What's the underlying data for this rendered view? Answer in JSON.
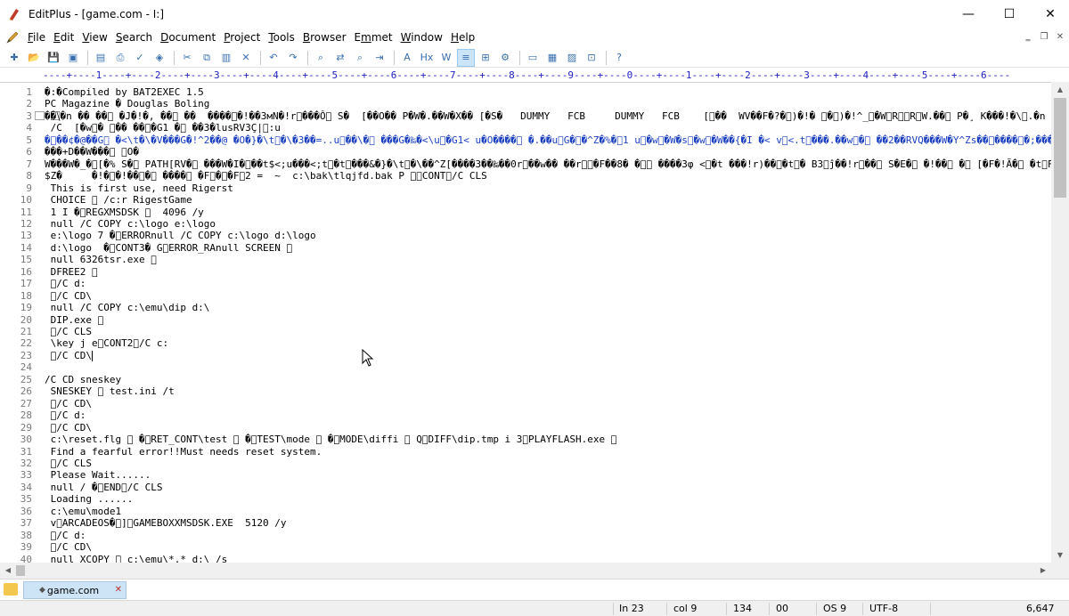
{
  "window": {
    "title": "EditPlus - [game.com - I:]",
    "controls": {
      "minimize": "—",
      "maximize": "☐",
      "close": "✕"
    }
  },
  "menu": [
    {
      "label": "File",
      "key": "F",
      "rest": "ile"
    },
    {
      "label": "Edit",
      "key": "E",
      "rest": "dit"
    },
    {
      "label": "View",
      "key": "V",
      "rest": "iew"
    },
    {
      "label": "Search",
      "key": "S",
      "rest": "earch"
    },
    {
      "label": "Document",
      "key": "D",
      "rest": "ocument"
    },
    {
      "label": "Project",
      "key": "P",
      "rest": "roject"
    },
    {
      "label": "Tools",
      "key": "T",
      "rest": "ools"
    },
    {
      "label": "Browser",
      "key": "B",
      "rest": "rowser"
    },
    {
      "label": "Emmet",
      "key": "m",
      "pre": "E",
      "rest": "met"
    },
    {
      "label": "Window",
      "key": "W",
      "rest": "indow"
    },
    {
      "label": "Help",
      "key": "H",
      "rest": "elp"
    }
  ],
  "mdi_controls": {
    "minimize": "‗",
    "restore": "❐",
    "close": "✕"
  },
  "toolbar": {
    "icons": [
      "new-file-icon",
      "open-icon",
      "save-icon",
      "save-all-icon",
      "sep",
      "print-preview-icon",
      "print-icon",
      "spell-check-icon",
      "browser-icon",
      "sep",
      "cut-icon",
      "copy-icon",
      "paste-icon",
      "delete-icon",
      "sep",
      "undo-icon",
      "redo-icon",
      "sep",
      "find-icon",
      "replace-icon",
      "find-in-files-icon",
      "goto-icon",
      "sep",
      "font-icon",
      "hex-icon",
      "word-wrap-icon",
      "line-number-icon",
      "ruler-icon",
      "preferences-icon",
      "sep",
      "monitor-icon",
      "cliptext-icon",
      "directory-icon",
      "output-icon",
      "sep",
      "help-icon"
    ],
    "glyphs": [
      "✚",
      "📂",
      "💾",
      "▣",
      "",
      "▤",
      "⎙",
      "✓",
      "◈",
      "",
      "✂",
      "⧉",
      "▥",
      "✕",
      "",
      "↶",
      "↷",
      "",
      "⌕",
      "⇄",
      "⌕",
      "⇥",
      "",
      "A",
      "Hx",
      "W",
      "≡",
      "⊞",
      "⚙",
      "",
      "▭",
      "▦",
      "▨",
      "⊡",
      "",
      "?"
    ]
  },
  "ruler": "----+----1----+----2----+----3----+----4----+----5----+----6----+----7----+----8----+----9----+----0----+----1----+----2----+----3----+----4----+----5----+----6----",
  "editor": {
    "lines": [
      {
        "n": "1",
        "t": "�:�Compiled by BAT2EXEC 1.5"
      },
      {
        "n": "2",
        "t": "PC Magazine � Douglas Boling"
      },
      {
        "n": "3",
        "t": "⃞��\\⃞�n �� ��⃞ �J�!�, ��⃞ ��  ����⃞�!��3мN�!r⃞���Ô⃞ S�  [��O�� P�W�.��W�X�� [�S�   DUMMY   FCB     DUMMY   FCB    [⃞��  WV��F�?�⃞)�!� ⃞�⃞)�!^_⃞�W⃞R⃞⃞R⃞W.��⃞ P�¸ K���!�\\⃞.�n ����"
      },
      {
        "n": "4",
        "t": " /C  [�w⃞� ⃞�� ��⃞�G1 �⃞ ��3�lusRV3Ç|⃞:u"
      },
      {
        "n": "5",
        "t": "�⃞��¢�@��G⃞ �<\\t�\\�V���G�!^2��@ �O�}�\\t⃞�\\�3��=..u⃞��\\�⃞ ���G�‰�<\\u⃞�G1< u�O����⃞ �.��u⃞G�⃞�^Z�%�⃞1 u⃞�w⃞�W�s⃞�w⃞�W��{�I �< v⃞<.t⃞���.��w⃞�⃞ ��2��RVQ���W�Y^Zs��⃞����⃞�;���⃞u3�w.��⃞��",
        "blue": true
      },
      {
        "n": "6",
        "t": "���+D��W���⃞ ⃞O�"
      },
      {
        "n": "7",
        "t": "W���W�_�⃞[�% S�⃞ PATH[RV�⃞ ���W�I�⃞��t$<;u���<;t⃞�t⃞���&�}�\\t⃞�\\��^Z[����3��‰��0r⃞��w�� ��r⃞⃞�F��8� �⃞⃞ ����3φ <⃞�t ���!r)��⃞�t⃞� B3⃞ĵ��!r⃞��⃞ S�E�⃞ �!��⃞ �⃞ [�F�!Ã�⃞ �t⃞F��⃞ �⃞ �!�"
      },
      {
        "n": "8",
        "t": "$Z�     �!�⃞�!��⃞�⃞ ����⃞ �F⃞�⃞�F⃞2 =  ~  c:\\bak\\tlqjfd.bak P ⃞⃞CONT⃞/C CLS"
      },
      {
        "n": "9",
        "t": " This is first use, need Rigerst"
      },
      {
        "n": "10",
        "t": " CHOICE ⃞ /c:r RigestGame"
      },
      {
        "n": "11",
        "t": " 1 I �⃞REGXMSDSK ⃞  4096 /y"
      },
      {
        "n": "12",
        "t": " null /C COPY c:\\logo e:\\logo"
      },
      {
        "n": "13",
        "t": " e:\\logo 7 �⃞ERRORnull /C COPY c:\\logo d:\\logo"
      },
      {
        "n": "14",
        "t": " d:\\logo  �⃞CONT3� G⃞ERROR_RAnull SCREEN ⃞"
      },
      {
        "n": "15",
        "t": " null 6326tsr.exe ⃞"
      },
      {
        "n": "16",
        "t": " DFREE2 ⃞"
      },
      {
        "n": "17",
        "t": " ⃞/C d:"
      },
      {
        "n": "18",
        "t": " ⃞/C CD\\"
      },
      {
        "n": "19",
        "t": " null /C COPY c:\\emu\\dip d:\\"
      },
      {
        "n": "20",
        "t": " DIP.exe ⃞"
      },
      {
        "n": "21",
        "t": " ⃞/C CLS"
      },
      {
        "n": "22",
        "t": " \\key j e⃞CONT2⃞/C c:"
      },
      {
        "n": "23",
        "t": " ⃞/C CD\\",
        "caret": true
      },
      {
        "n": "24",
        "t": ""
      },
      {
        "n": "25",
        "t": "/C CD sneskey"
      },
      {
        "n": "26",
        "t": " SNESKEY ⃞ test.ini /t"
      },
      {
        "n": "27",
        "t": " ⃞/C CD\\"
      },
      {
        "n": "28",
        "t": " ⃞/C d:"
      },
      {
        "n": "29",
        "t": " ⃞/C CD\\"
      },
      {
        "n": "30",
        "t": " c:\\reset.flg ⃞ �⃞RET_CONT\\test ⃞ �⃞TEST\\mode ⃞ �⃞MODE\\diffi ⃞ Q⃞DIFF\\dip.tmp i 3⃞PLAYFLASH.exe ⃞"
      },
      {
        "n": "31",
        "t": " Find a fearful error!!Must needs reset system."
      },
      {
        "n": "32",
        "t": " ⃞/C CLS"
      },
      {
        "n": "33",
        "t": " Please Wait......"
      },
      {
        "n": "34",
        "t": " null / �⃞END⃞/C CLS"
      },
      {
        "n": "35",
        "t": " Loading ......"
      },
      {
        "n": "36",
        "t": " c:\\emu\\mode1"
      },
      {
        "n": "37",
        "t": " v⃞ARCADEOS�⃞]⃞GAMEBOXXMSDSK.EXE  5120 /y"
      },
      {
        "n": "38",
        "t": " ⃞/C d:"
      },
      {
        "n": "39",
        "t": " ⃞/C CD\\"
      },
      {
        "n": "40",
        "t": " null XCOPY ⃞ c:\\emu\\*.* d:\\ /s"
      }
    ]
  },
  "tabs": [
    {
      "label": "game.com",
      "icon": "◆",
      "close": "✕"
    }
  ],
  "status": {
    "line": "In 23",
    "col": "col 9",
    "code": "134",
    "hex": "00",
    "os": "OS 9",
    "encoding": "UTF-8",
    "size": "6,647"
  }
}
